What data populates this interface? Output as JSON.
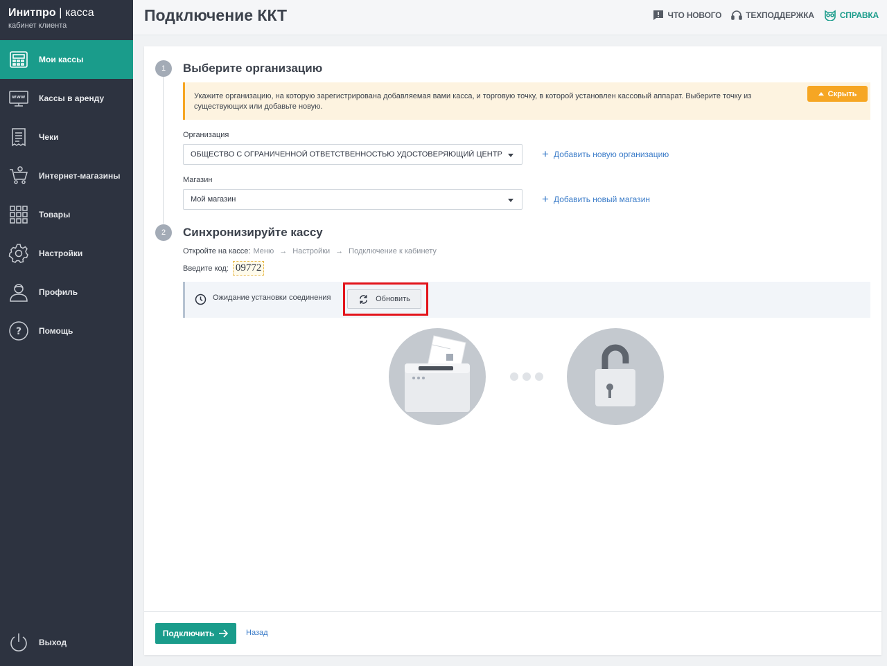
{
  "brand": {
    "name_bold": "Инитпро",
    "separator": " | ",
    "name_thin": "касса",
    "subtitle": "кабинет клиента"
  },
  "sidebar": {
    "items": [
      {
        "label": "Мои кассы",
        "icon": "cash-register-icon",
        "active": true
      },
      {
        "label": "Кассы в аренду",
        "icon": "www-monitor-icon"
      },
      {
        "label": "Чеки",
        "icon": "receipt-icon"
      },
      {
        "label": "Интернет-магазины",
        "icon": "shopping-cart-icon"
      },
      {
        "label": "Товары",
        "icon": "grid-icon"
      },
      {
        "label": "Настройки",
        "icon": "gear-icon"
      },
      {
        "label": "Профиль",
        "icon": "user-icon"
      },
      {
        "label": "Помощь",
        "icon": "help-icon"
      }
    ],
    "logout_label": "Выход"
  },
  "header": {
    "title": "Подключение ККТ",
    "links": [
      {
        "label": "ЧТО НОВОГО",
        "icon": "chat-alert-icon"
      },
      {
        "label": "ТЕХПОДДЕРЖКА",
        "icon": "headset-icon"
      },
      {
        "label": "СПРАВКА",
        "icon": "owl-icon"
      }
    ]
  },
  "step1": {
    "number": "1",
    "title": "Выберите организацию",
    "notice": "Укажите организацию, на которую зарегистрирована добавляемая вами касса, и торговую точку, в которой установлен кассовый аппарат. Выберите точку из существующих или добавьте новую.",
    "hide_label": "Скрыть",
    "org_label": "Организация",
    "org_value": "ОБЩЕСТВО С ОГРАНИЧЕННОЙ ОТВЕТСТВЕННОСТЬЮ УДОСТОВЕРЯЮЩИЙ ЦЕНТР",
    "add_org": "Добавить новую организацию",
    "shop_label": "Магазин",
    "shop_value": "Мой магазин",
    "add_shop": "Добавить новый магазин"
  },
  "step2": {
    "number": "2",
    "title": "Синхронизируйте кассу",
    "open_on_kkt": "Откройте на кассе:",
    "path": [
      "Меню",
      "Настройки",
      "Подключение к кабинету"
    ],
    "path_arrow": "→",
    "enter_code_label": "Введите код:",
    "code": "09772",
    "status_text": "Ожидание установки соединения",
    "refresh_label": "Обновить"
  },
  "footer": {
    "connect_label": "Подключить",
    "back_label": "Назад"
  },
  "colors": {
    "sidebar": "#2d3340",
    "accent": "#1a9c8b",
    "warning": "#f6a623",
    "link": "#3a7bc8",
    "highlight": "#e3141b"
  }
}
